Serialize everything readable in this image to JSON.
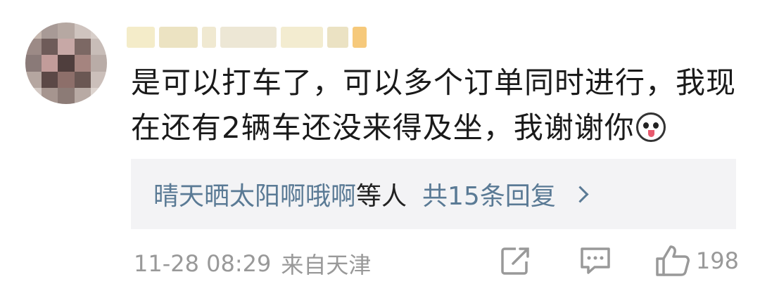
{
  "comment": {
    "text": "是可以打车了，可以多个订单同时进行，我现在还有2辆车还没来得及坐，我谢谢你",
    "emoji_icon": "laughing-dog-face-icon"
  },
  "replies": {
    "users_text": "晴天晒太阳啊哦啊",
    "suffix_text": "等人",
    "count_text": "共15条回复"
  },
  "meta": {
    "date": "11-28 08:29",
    "location": "来自天津"
  },
  "actions": {
    "share_icon": "share-icon",
    "comment_icon": "comment-icon",
    "like_icon": "thumbs-up-icon",
    "like_count": "198"
  },
  "colors": {
    "link": "#5a7a95",
    "meta": "#999999",
    "reply_bg": "#f3f3f5"
  }
}
